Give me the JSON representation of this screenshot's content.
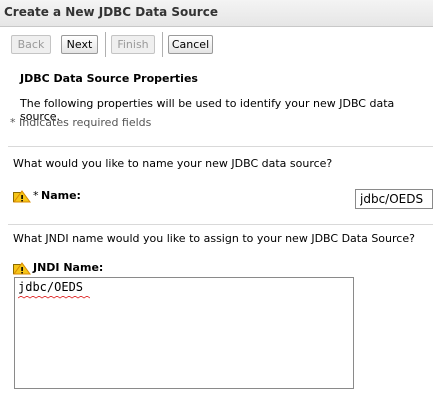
{
  "window": {
    "title": "Create a New JDBC Data Source"
  },
  "toolbar": {
    "back": "Back",
    "next": "Next",
    "finish": "Finish",
    "cancel": "Cancel"
  },
  "properties": {
    "heading": "JDBC Data Source Properties",
    "description": "The following properties will be used to identify your new JDBC data source.",
    "required_note": "* Indicates required fields"
  },
  "name_section": {
    "question": "What would you like to name your new JDBC data source?",
    "required_mark": "*",
    "label": "Name:",
    "value": "jdbc/OEDS"
  },
  "jndi_section": {
    "question": "What JNDI name would you like to assign to your new JDBC Data Source?",
    "label": "JNDI Name:",
    "value": "jdbc/OEDS"
  },
  "colors": {
    "icon_yellow": "#f5c518",
    "icon_orange": "#d98a00",
    "squiggle": "#e03030"
  }
}
